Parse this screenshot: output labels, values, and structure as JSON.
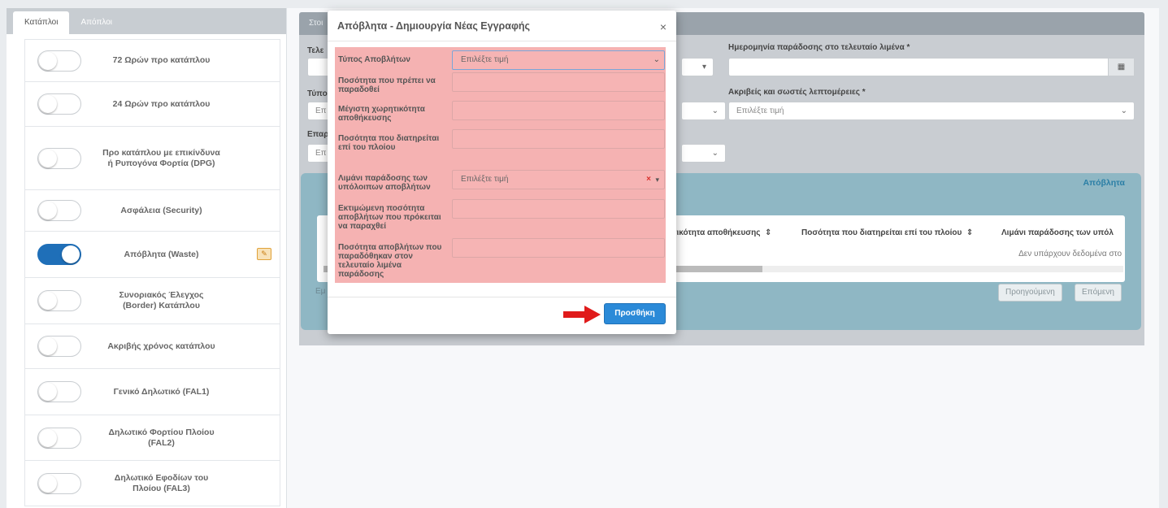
{
  "sidebar": {
    "tabs": [
      "Κατάπλοι",
      "Απόπλοι"
    ],
    "items": [
      {
        "label": "72 Ωρών προ κατάπλου",
        "on": false,
        "badge": false
      },
      {
        "label": "24 Ωρών προ κατάπλου",
        "on": false,
        "badge": false
      },
      {
        "label": "Προ κατάπλου με επικίνδυνα ή Ρυπογόνα Φορτία (DPG)",
        "on": false,
        "badge": false
      },
      {
        "label": "Ασφάλεια (Security)",
        "on": false,
        "badge": false
      },
      {
        "label": "Απόβλητα (Waste)",
        "on": true,
        "badge": true
      },
      {
        "label": "Συνοριακός Έλεγχος (Border) Κατάπλου",
        "on": false,
        "badge": false
      },
      {
        "label": "Ακριβής χρόνος κατάπλου",
        "on": false,
        "badge": false
      },
      {
        "label": "Γενικό Δηλωτικό (FAL1)",
        "on": false,
        "badge": false
      },
      {
        "label": "Δηλωτικό Φορτίου Πλοίου (FAL2)",
        "on": false,
        "badge": false
      },
      {
        "label": "Δηλωτικό Εφοδίων του Πλοίου (FAL3)",
        "on": false,
        "badge": false
      }
    ]
  },
  "main": {
    "header_fragment": "Στοι",
    "fields": {
      "left_label_1": "Τελε",
      "left_label_2": "Τύπο",
      "left_label_3": "Επαρ",
      "left_value_2": "Επ",
      "left_value_3": "Επ",
      "delivery_date_label": "Ημερομηνία παράδοσης στο τελευταίο λιμένα *",
      "details_label": "Ακριβείς και σωστές λεπτομέρειες *",
      "details_value": "Επιλέξτε τιμή"
    },
    "panel_title": "Απόβλητα",
    "table_headers": [
      "τικότητα αποθήκευσης",
      "Ποσότητα που διατηρείται επί του πλοίου",
      "Λιμάνι παράδοσης των υπόλ"
    ],
    "no_data": "Δεν υπάρχουν δεδομένα στο",
    "entries_fragment": "Εμ",
    "prev": "Προηγούμενη",
    "next": "Επόμενη"
  },
  "modal": {
    "title": "Απόβλητα - Δημιουργία Νέας Εγγραφής",
    "close": "×",
    "fields": [
      {
        "label": "Τύπος Αποβλήτων",
        "value": "Επιλέξτε τιμή"
      },
      {
        "label": "Ποσότητα που πρέπει να παραδοθεί",
        "value": ""
      },
      {
        "label": "Μέγιστη χωρητικότητα αποθήκευσης",
        "value": ""
      },
      {
        "label": "Ποσότητα που διατηρείται επί του πλοίου",
        "value": ""
      },
      {
        "label": "Λιμάνι παράδοσης των υπόλοιπων αποβλήτων",
        "value": "Επιλέξτε τιμή"
      },
      {
        "label": "Εκτιμώμενη ποσότητα αποβλήτων που πρόκειται να παραχθεί",
        "value": ""
      },
      {
        "label": "Ποσότητα αποβλήτων που παραδόθηκαν στον τελευταίο λιμένα παράδοσης",
        "value": ""
      }
    ],
    "add_label": "Προσθήκη"
  },
  "colors": {
    "highlight": "#f5b2b2",
    "primary": "#2b8ad8",
    "arrow": "#e01b1b",
    "toggle_on": "#1f6fb8"
  }
}
